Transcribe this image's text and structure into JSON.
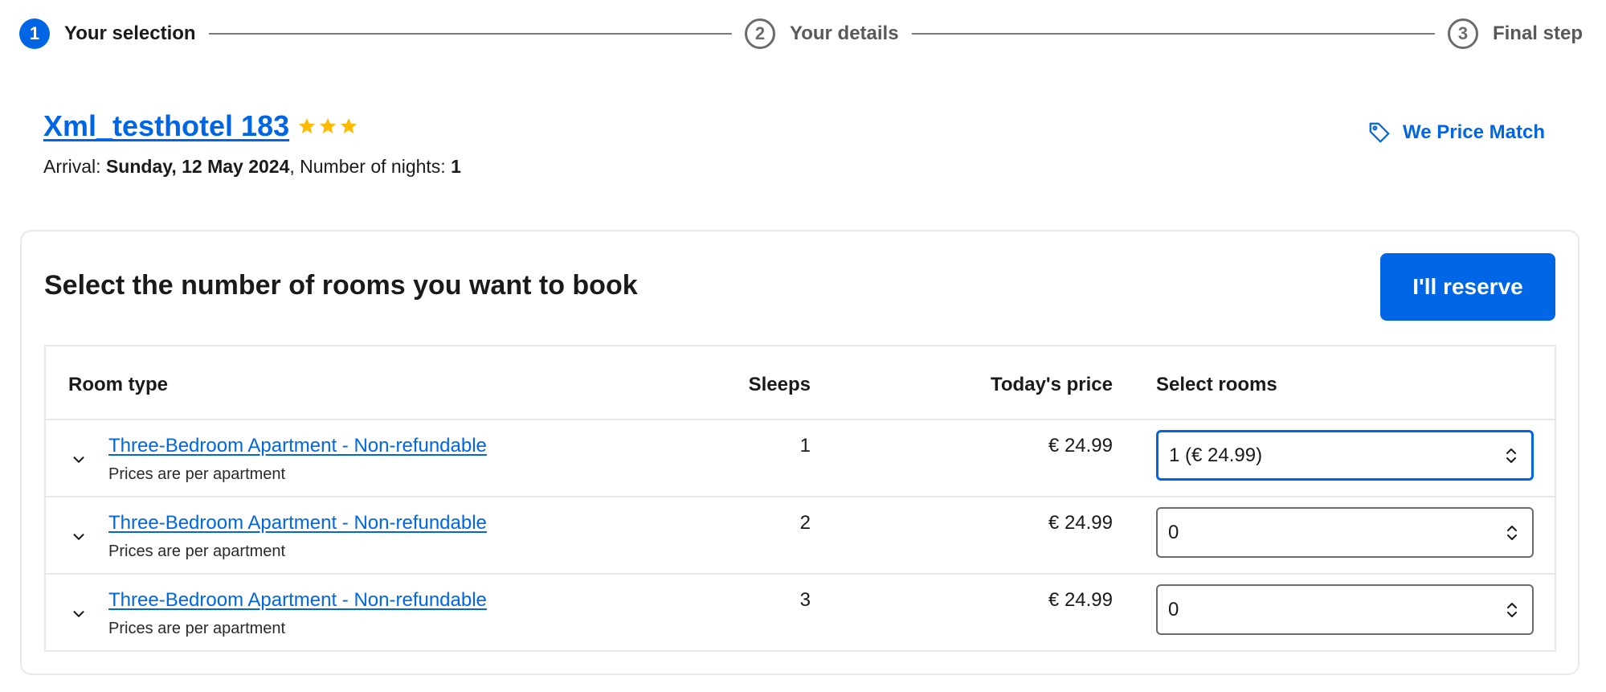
{
  "steps": [
    {
      "number": "1",
      "label": "Your selection",
      "state": "active"
    },
    {
      "number": "2",
      "label": "Your details",
      "state": "inactive"
    },
    {
      "number": "3",
      "label": "Final step",
      "state": "inactive"
    }
  ],
  "hotel": {
    "name": "Xml_testhotel 183",
    "stars": 3,
    "arrival_label": "Arrival: ",
    "arrival_date": "Sunday, 12 May 2024",
    "nights_label": ", Number of nights: ",
    "nights": "1"
  },
  "price_match": {
    "label": "We Price Match",
    "icon": "tag-icon"
  },
  "card": {
    "title": "Select the number of rooms you want to book",
    "reserve_label": "I'll reserve"
  },
  "table": {
    "headers": {
      "room_type": "Room type",
      "sleeps": "Sleeps",
      "price": "Today's price",
      "select": "Select rooms"
    },
    "rows": [
      {
        "room": "Three-Bedroom Apartment - Non-refundable",
        "note": "Prices are per apartment",
        "sleeps": "1",
        "price": "€ 24.99",
        "selected": "1 (€ 24.99)"
      },
      {
        "room": "Three-Bedroom Apartment - Non-refundable",
        "note": "Prices are per apartment",
        "sleeps": "2",
        "price": "€ 24.99",
        "selected": "0"
      },
      {
        "room": "Three-Bedroom Apartment - Non-refundable",
        "note": "Prices are per apartment",
        "sleeps": "3",
        "price": "€ 24.99",
        "selected": "0"
      }
    ]
  },
  "colors": {
    "accent": "#0066e6",
    "star": "#febb02",
    "inactive": "#6b6b6b"
  }
}
